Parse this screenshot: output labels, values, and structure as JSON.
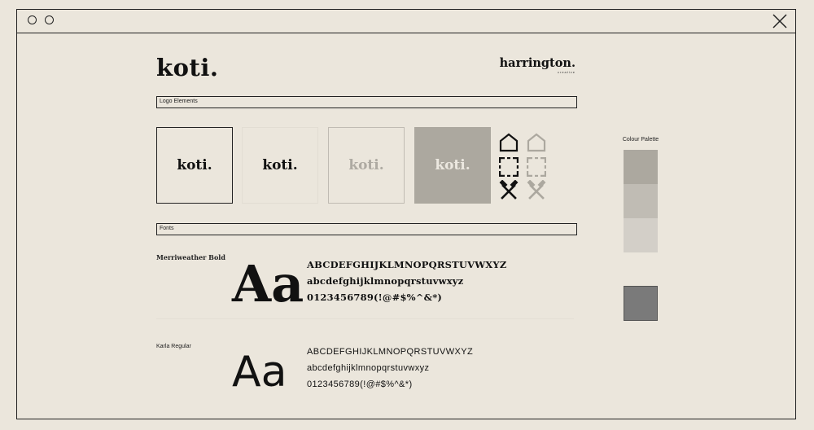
{
  "brand": {
    "logo_text": "koti."
  },
  "studio": {
    "name": "harrington.",
    "sub": "creative"
  },
  "sections": {
    "logo_elements": "Logo Elements",
    "fonts": "Fonts"
  },
  "logo_tiles": [
    {
      "text": "koti."
    },
    {
      "text": "koti."
    },
    {
      "text": "koti."
    },
    {
      "text": "koti."
    }
  ],
  "icons": {
    "rows": [
      "house-icon",
      "frame-corners-icon",
      "crossed-hammers-icon"
    ],
    "dark_color": "#111111",
    "light_color": "#aca89f"
  },
  "fonts": [
    {
      "name": "Merriweather Bold",
      "sample": "Aa",
      "uppercase": "ABCDEFGHIJKLMNOPQRSTUVWXYZ",
      "lowercase": "abcdefghijklmnopqrstuvwxyz",
      "symbols": "0123456789(!@#$%^&*)"
    },
    {
      "name": "Karla Regular",
      "sample": "Aa",
      "uppercase": "ABCDEFGHIJKLMNOPQRSTUVWXYZ",
      "lowercase": "abcdefghijklmnopqrstuvwxyz",
      "symbols": "0123456789(!@#$%^&*)"
    }
  ],
  "palette": {
    "title": "Colour Palette",
    "swatches": [
      "#aca89f",
      "#c0bcb4",
      "#d3cfc8",
      "#7a7a7a"
    ]
  }
}
